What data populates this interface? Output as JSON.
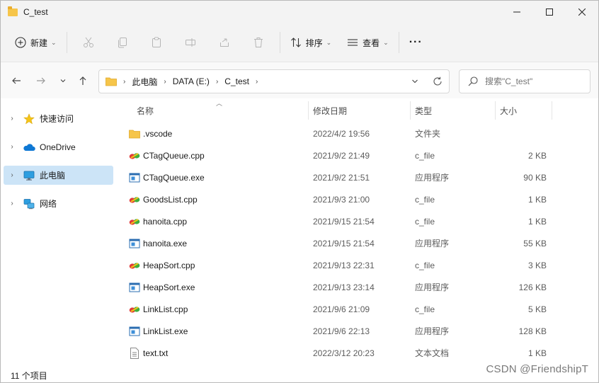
{
  "window": {
    "title": "C_test",
    "controls": {
      "minimize": "—",
      "maximize": "☐",
      "close": "✕"
    }
  },
  "toolbar": {
    "new_label": "新建",
    "sort_label": "排序",
    "view_label": "查看",
    "more_label": "···",
    "icons": [
      "cut-icon",
      "copy-icon",
      "paste-icon",
      "rename-icon",
      "share-icon",
      "delete-icon"
    ]
  },
  "address": {
    "crumbs": [
      "此电脑",
      "DATA (E:)",
      "C_test"
    ]
  },
  "search": {
    "placeholder": "搜索\"C_test\""
  },
  "sidebar": {
    "items": [
      {
        "label": "快速访问",
        "icon": "star-icon"
      },
      {
        "label": "OneDrive",
        "icon": "cloud-icon"
      },
      {
        "label": "此电脑",
        "icon": "pc-icon",
        "selected": true
      },
      {
        "label": "网络",
        "icon": "network-icon"
      }
    ]
  },
  "columns": {
    "name": "名称",
    "date": "修改日期",
    "type": "类型",
    "size": "大小"
  },
  "files": [
    {
      "name": ".vscode",
      "date": "2022/4/2 19:56",
      "type": "文件夹",
      "size": "",
      "icon": "folder-icon"
    },
    {
      "name": "CTagQueue.cpp",
      "date": "2021/9/2 21:49",
      "type": "c_file",
      "size": "2 KB",
      "icon": "cpp-file-icon"
    },
    {
      "name": "CTagQueue.exe",
      "date": "2021/9/2 21:51",
      "type": "应用程序",
      "size": "90 KB",
      "icon": "exe-file-icon"
    },
    {
      "name": "GoodsList.cpp",
      "date": "2021/9/3 21:00",
      "type": "c_file",
      "size": "1 KB",
      "icon": "cpp-file-icon"
    },
    {
      "name": "hanoita.cpp",
      "date": "2021/9/15 21:54",
      "type": "c_file",
      "size": "1 KB",
      "icon": "cpp-file-icon"
    },
    {
      "name": "hanoita.exe",
      "date": "2021/9/15 21:54",
      "type": "应用程序",
      "size": "55 KB",
      "icon": "exe-file-icon"
    },
    {
      "name": "HeapSort.cpp",
      "date": "2021/9/13 22:31",
      "type": "c_file",
      "size": "3 KB",
      "icon": "cpp-file-icon"
    },
    {
      "name": "HeapSort.exe",
      "date": "2021/9/13 23:14",
      "type": "应用程序",
      "size": "126 KB",
      "icon": "exe-file-icon"
    },
    {
      "name": "LinkList.cpp",
      "date": "2021/9/6 21:09",
      "type": "c_file",
      "size": "5 KB",
      "icon": "cpp-file-icon"
    },
    {
      "name": "LinkList.exe",
      "date": "2021/9/6 22:13",
      "type": "应用程序",
      "size": "128 KB",
      "icon": "exe-file-icon"
    },
    {
      "name": "text.txt",
      "date": "2022/3/12 20:23",
      "type": "文本文档",
      "size": "1 KB",
      "icon": "text-file-icon"
    }
  ],
  "status": {
    "count": "11 个项目"
  },
  "watermark": "CSDN @FriendshipT",
  "colors": {
    "accent": "#0067c0",
    "selection": "#cce4f7",
    "folder": "#f6c54a",
    "chrome": "#f3f3f3"
  }
}
